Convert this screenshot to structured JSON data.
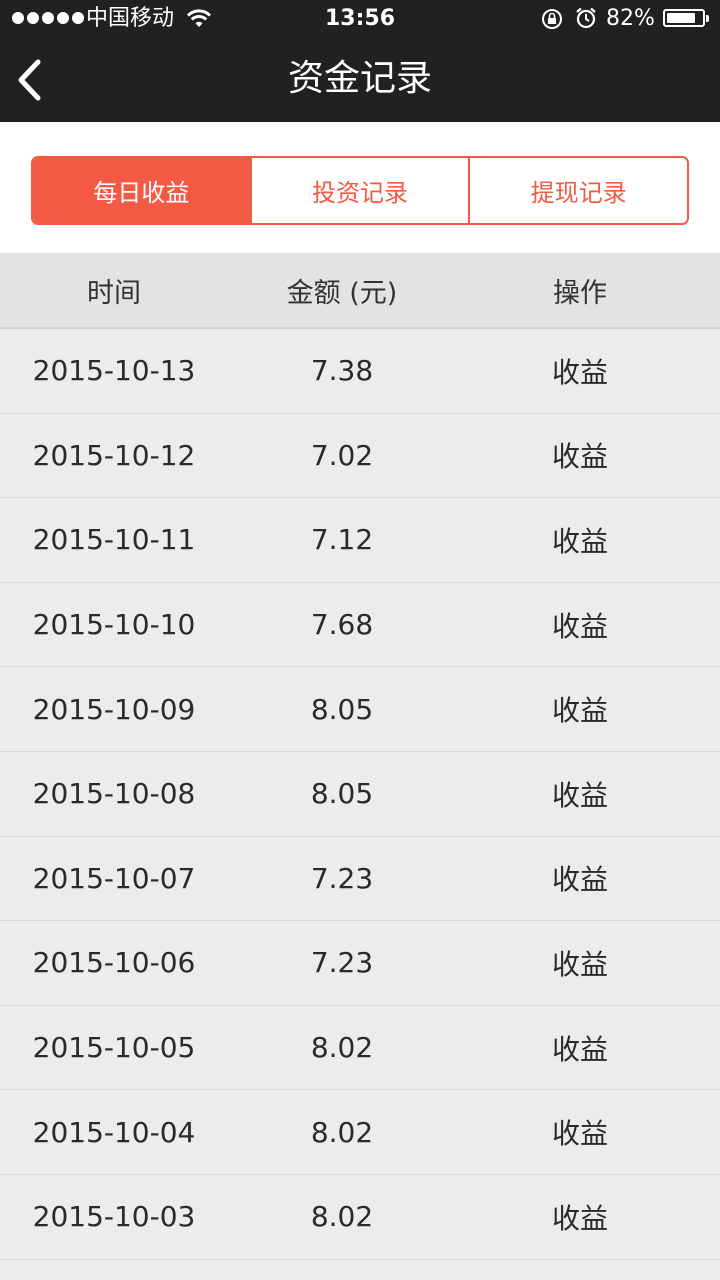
{
  "status_bar": {
    "carrier": "中国移动",
    "time": "13:56",
    "battery_percent": "82%",
    "battery_level": 0.82
  },
  "nav": {
    "title": "资金记录",
    "back_icon": "chevron-left-icon"
  },
  "tabs": [
    {
      "label": "每日收益",
      "active": true
    },
    {
      "label": "投资记录",
      "active": false
    },
    {
      "label": "提现记录",
      "active": false
    }
  ],
  "table": {
    "headers": {
      "date": "时间",
      "amount": "金额 (元)",
      "operation": "操作"
    },
    "rows": [
      {
        "date": "2015-10-13",
        "amount": "7.38",
        "operation": "收益"
      },
      {
        "date": "2015-10-12",
        "amount": "7.02",
        "operation": "收益"
      },
      {
        "date": "2015-10-11",
        "amount": "7.12",
        "operation": "收益"
      },
      {
        "date": "2015-10-10",
        "amount": "7.68",
        "operation": "收益"
      },
      {
        "date": "2015-10-09",
        "amount": "8.05",
        "operation": "收益"
      },
      {
        "date": "2015-10-08",
        "amount": "8.05",
        "operation": "收益"
      },
      {
        "date": "2015-10-07",
        "amount": "7.23",
        "operation": "收益"
      },
      {
        "date": "2015-10-06",
        "amount": "7.23",
        "operation": "收益"
      },
      {
        "date": "2015-10-05",
        "amount": "8.02",
        "operation": "收益"
      },
      {
        "date": "2015-10-04",
        "amount": "8.02",
        "operation": "收益"
      },
      {
        "date": "2015-10-03",
        "amount": "8.02",
        "operation": "收益"
      }
    ]
  },
  "colors": {
    "accent": "#f25a44",
    "topbar": "#202123"
  }
}
